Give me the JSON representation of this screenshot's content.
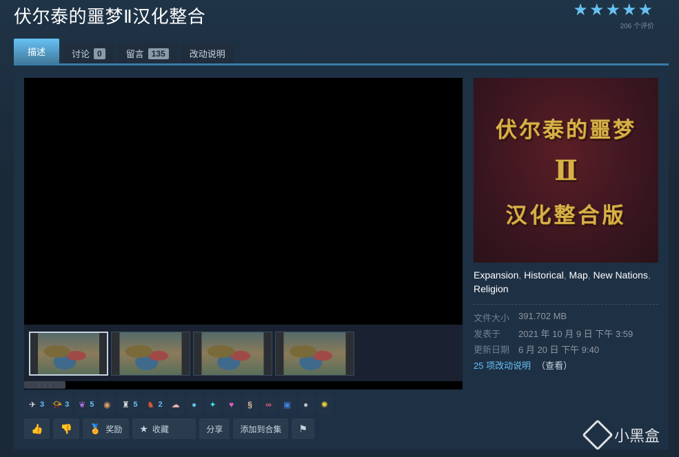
{
  "page": {
    "title": "伏尔泰的噩梦Ⅱ汉化整合"
  },
  "rating": {
    "stars": "★★★★★",
    "count_text": "206 个评价"
  },
  "tabs": [
    {
      "label": "描述"
    },
    {
      "label": "讨论",
      "badge": "0"
    },
    {
      "label": "留言",
      "badge": "135"
    },
    {
      "label": "改动说明"
    }
  ],
  "cover": {
    "line1": "伏尔泰的噩梦",
    "line2": "Ⅱ",
    "line3": "汉化整合版"
  },
  "tags": [
    "Expansion",
    "Historical",
    "Map",
    "New Nations",
    "Religion"
  ],
  "meta": {
    "size_label": "文件大小",
    "size_value": "391.702 MB",
    "posted_label": "发表于",
    "posted_value": "2021 年 10 月 9 日 下午 3:59",
    "updated_label": "更新日期",
    "updated_value": "6 月 20 日 下午 9:40",
    "changes_link": "25 项改动说明",
    "changes_view": "（查看）"
  },
  "awards": [
    {
      "icon": "wings-award-icon",
      "glyph": "✈",
      "color": "#e0e0e0",
      "count": "3"
    },
    {
      "icon": "horn-award-icon",
      "glyph": "📯",
      "color": "#e08a20",
      "count": "3"
    },
    {
      "icon": "hearts-award-icon",
      "glyph": "❦",
      "color": "#b070e0",
      "count": "5"
    },
    {
      "icon": "shell-award-icon",
      "glyph": "◉",
      "color": "#e0a060",
      "count": ""
    },
    {
      "icon": "statue-award-icon",
      "glyph": "♜",
      "color": "#e0e0e0",
      "count": "5"
    },
    {
      "icon": "dragon-award-icon",
      "glyph": "♞",
      "color": "#e05a30",
      "count": "2"
    },
    {
      "icon": "brain-award-icon",
      "glyph": "☁",
      "color": "#f0b0b0",
      "count": ""
    },
    {
      "icon": "slime-award-icon",
      "glyph": "●",
      "color": "#60c0e0",
      "count": ""
    },
    {
      "icon": "comet-award-icon",
      "glyph": "✦",
      "color": "#40e0e0",
      "count": ""
    },
    {
      "icon": "heart-award-icon",
      "glyph": "♥",
      "color": "#e060c0",
      "count": ""
    },
    {
      "icon": "scroll-award-icon",
      "glyph": "§",
      "color": "#e0c090",
      "count": ""
    },
    {
      "icon": "fish-award-icon",
      "glyph": "∞",
      "color": "#e06080",
      "count": ""
    },
    {
      "icon": "cake-award-icon",
      "glyph": "▣",
      "color": "#4080e0",
      "count": ""
    },
    {
      "icon": "mic-award-icon",
      "glyph": "●",
      "color": "#c0c0c0",
      "count": ""
    },
    {
      "icon": "sun-award-icon",
      "glyph": "✺",
      "color": "#f0d030",
      "count": ""
    }
  ],
  "actions": {
    "award_label": "奖励",
    "favorite_label": "收藏",
    "share_label": "分享",
    "collection_label": "添加到合集"
  },
  "watermark": {
    "text": "小黑盒"
  },
  "colors": {
    "accent": "#66c0f4",
    "star": "#a4d007",
    "panel_border": "#3b7ca8"
  }
}
